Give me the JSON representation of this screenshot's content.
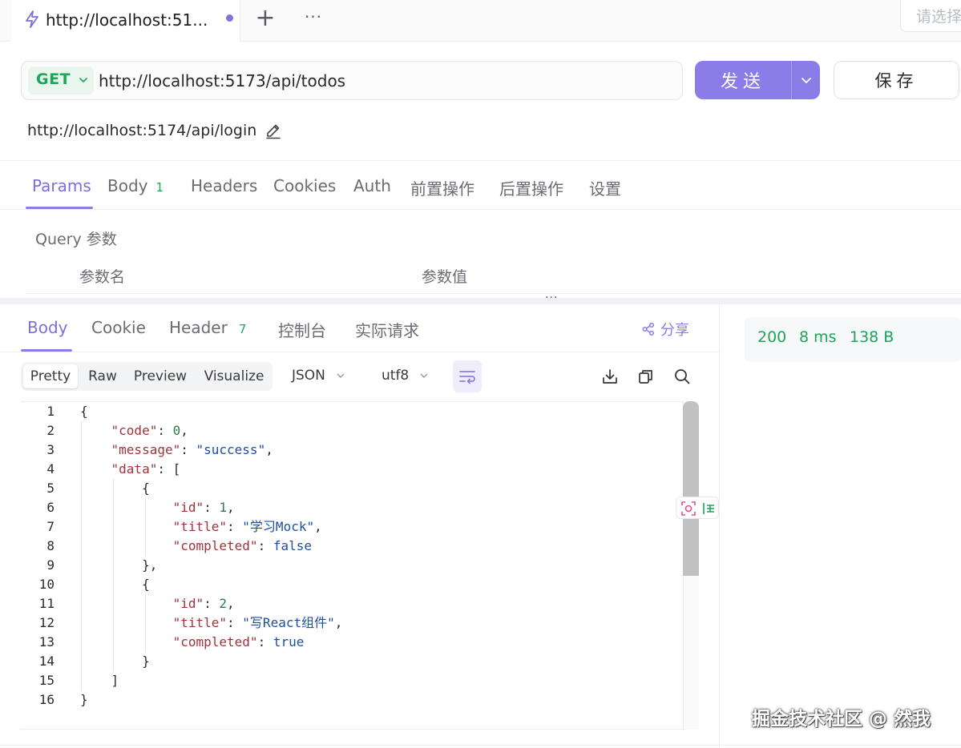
{
  "tabbar": {
    "tab_title": "http://localhost:51...",
    "add_label": "+",
    "more_label": "···",
    "env_placeholder": "请选择"
  },
  "request": {
    "method": "GET",
    "url": "http://localhost:5173/api/todos",
    "send_label": "发送",
    "save_label": "保存",
    "name": "http://localhost:5174/api/login"
  },
  "request_tabs": [
    {
      "label": "Params"
    },
    {
      "label": "Body",
      "badge": "1"
    },
    {
      "label": "Headers"
    },
    {
      "label": "Cookies"
    },
    {
      "label": "Auth"
    },
    {
      "label": "前置操作"
    },
    {
      "label": "后置操作"
    },
    {
      "label": "设置"
    }
  ],
  "params": {
    "title": "Query 参数",
    "col_name": "参数名",
    "col_value": "参数值"
  },
  "response_tabs": [
    {
      "label": "Body"
    },
    {
      "label": "Cookie"
    },
    {
      "label": "Header",
      "badge": "7"
    },
    {
      "label": "控制台"
    },
    {
      "label": "实际请求"
    }
  ],
  "share_label": "分享",
  "format": {
    "views": [
      "Pretty",
      "Raw",
      "Preview",
      "Visualize"
    ],
    "type": "JSON",
    "encoding": "utf8"
  },
  "status": {
    "code": "200",
    "time": "8 ms",
    "size": "138 B"
  },
  "code_lines": [
    {
      "n": "1",
      "t": "{"
    },
    {
      "n": "2",
      "t": "    \"code\": 0,"
    },
    {
      "n": "3",
      "t": "    \"message\": \"success\","
    },
    {
      "n": "4",
      "t": "    \"data\": ["
    },
    {
      "n": "5",
      "t": "        {"
    },
    {
      "n": "6",
      "t": "            \"id\": 1,"
    },
    {
      "n": "7",
      "t": "            \"title\": \"学习Mock\","
    },
    {
      "n": "8",
      "t": "            \"completed\": false"
    },
    {
      "n": "9",
      "t": "        },"
    },
    {
      "n": "10",
      "t": "        {"
    },
    {
      "n": "11",
      "t": "            \"id\": 2,"
    },
    {
      "n": "12",
      "t": "            \"title\": \"写React组件\","
    },
    {
      "n": "13",
      "t": "            \"completed\": true"
    },
    {
      "n": "14",
      "t": "        }"
    },
    {
      "n": "15",
      "t": "    ]"
    },
    {
      "n": "16",
      "t": "}"
    }
  ],
  "watermark": "掘金技术社区 @ 然我",
  "colors": {
    "accent": "#8b7de8",
    "method_green": "#1ea55a",
    "json_key": "#a3323a",
    "json_value": "#1f4fa3"
  }
}
